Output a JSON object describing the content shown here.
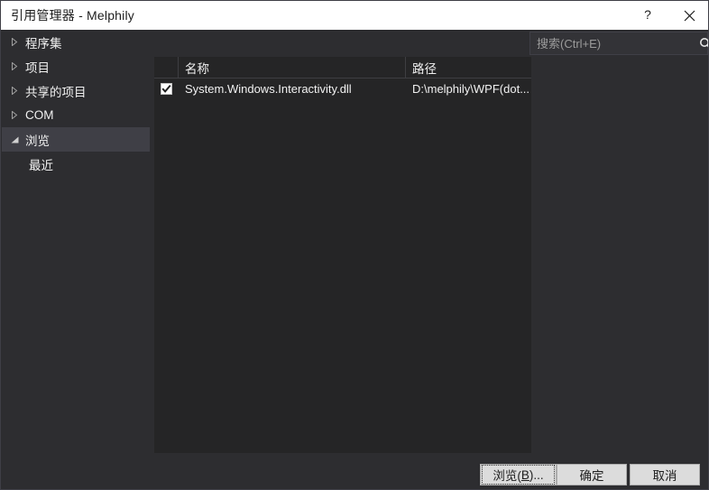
{
  "window": {
    "title": "引用管理器 - Melphily",
    "help_label": "?",
    "close_label": "×"
  },
  "sidebar": {
    "items": [
      {
        "label": "程序集",
        "state": "collapsed",
        "selected": false,
        "child": false
      },
      {
        "label": "项目",
        "state": "collapsed",
        "selected": false,
        "child": false
      },
      {
        "label": "共享的项目",
        "state": "collapsed",
        "selected": false,
        "child": false
      },
      {
        "label": "COM",
        "state": "collapsed",
        "selected": false,
        "child": false
      },
      {
        "label": "浏览",
        "state": "expanded",
        "selected": true,
        "child": false
      },
      {
        "label": "最近",
        "state": "leaf",
        "selected": false,
        "child": true
      }
    ]
  },
  "search": {
    "placeholder": "搜索(Ctrl+E)",
    "value": "",
    "icon": "search-icon",
    "dropdown_icon": "chevron-down-icon"
  },
  "list": {
    "columns": [
      {
        "key": "check",
        "label": ""
      },
      {
        "key": "name",
        "label": "名称"
      },
      {
        "key": "path",
        "label": "路径"
      }
    ],
    "rows": [
      {
        "checked": true,
        "name": "System.Windows.Interactivity.dll",
        "path": "D:\\melphily\\WPF(dot..."
      }
    ]
  },
  "footer": {
    "browse_label_pre": "浏览(",
    "browse_accesskey": "B",
    "browse_label_post": ")...",
    "ok_label": "确定",
    "cancel_label": "取消"
  },
  "colors": {
    "dialog_bg": "#2d2d30",
    "list_bg": "#252526",
    "titlebar_bg": "#ffffff",
    "selected_item_bg": "#3f3f46",
    "text": "#f1f1f1",
    "button_bg": "#dcdcdc"
  }
}
